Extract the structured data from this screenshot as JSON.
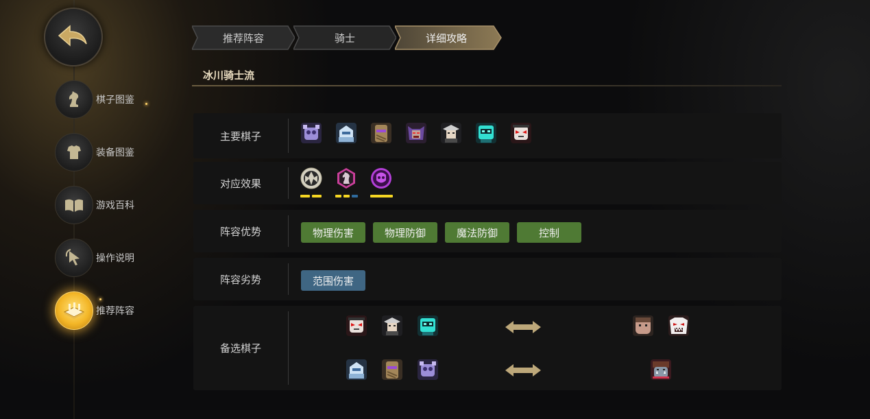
{
  "sidebar": {
    "back": {
      "icon": "back-arrow-icon"
    },
    "items": [
      {
        "label": "棋子图鉴",
        "icon": "knight-icon",
        "active": false
      },
      {
        "label": "装备图鉴",
        "icon": "armor-icon",
        "active": false
      },
      {
        "label": "游戏百科",
        "icon": "book-icon",
        "active": false
      },
      {
        "label": "操作说明",
        "icon": "pointer-icon",
        "active": false
      },
      {
        "label": "推荐阵容",
        "icon": "board-icon",
        "active": true
      }
    ]
  },
  "breadcrumb": [
    "推荐阵容",
    "骑士",
    "详细攻略"
  ],
  "lineup": {
    "title": "冰川骑士流",
    "rows": {
      "main": {
        "label": "主要棋子"
      },
      "effects": {
        "label": "对应效果"
      },
      "strengths": {
        "label": "阵容优势",
        "tags": [
          "物理伤害",
          "物理防御",
          "魔法防御",
          "控制"
        ]
      },
      "weaknesses": {
        "label": "阵容劣势",
        "tags": [
          "范围伤害"
        ]
      },
      "alternates": {
        "label": "备选棋子"
      }
    }
  },
  "colors": {
    "good_tag": "#4f7a34",
    "bad_tag": "#3f6683",
    "active_gold": "#f3b627",
    "synergy_yellow": "#f5d623",
    "synergy_blue": "#2f6a9c"
  }
}
